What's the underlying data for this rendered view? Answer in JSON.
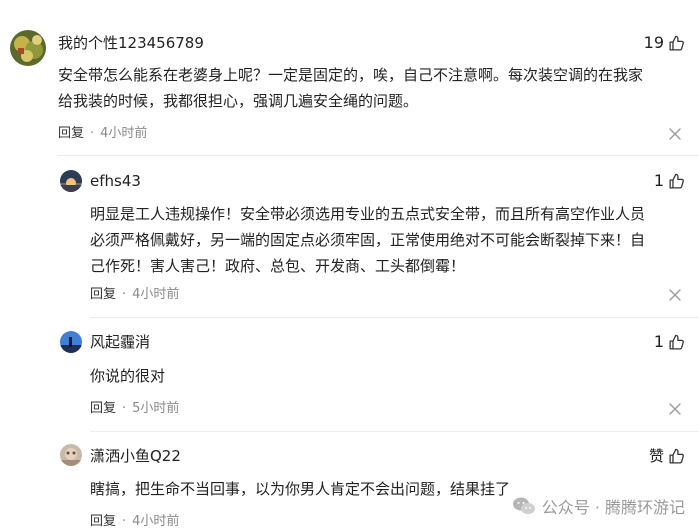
{
  "comments": [
    {
      "username": "我的个性123456789",
      "likes": "19",
      "lines": [
        "安全带怎么能系在老婆身上呢？一定是固定的，唉，自己不注意啊。每次装空调的在我家",
        "给我装的时候，我都很担心，强调几遍安全绳的问题。"
      ],
      "reply_label": "回复",
      "dot": "·",
      "time": "4小时前"
    },
    {
      "username": "efhs43",
      "likes": "1",
      "lines": [
        "明显是工人违规操作！安全带必须选用专业的五点式安全带，而且所有高空作业人员",
        "必须严格佩戴好，另一端的固定点必须牢固，正常使用绝对不可能会断裂掉下来！自",
        "己作死！害人害己！政府、总包、开发商、工头都倒霉！"
      ],
      "reply_label": "回复",
      "dot": "·",
      "time": "4小时前"
    },
    {
      "username": "风起霾消",
      "likes": "1",
      "lines": [
        "你说的很对"
      ],
      "reply_label": "回复",
      "dot": "·",
      "time": "5小时前"
    },
    {
      "username": "潇洒小鱼Q22",
      "likes": "赞",
      "lines": [
        "瞎搞，把生命不当回事，以为你男人肯定不会出问题，结果挂了"
      ],
      "reply_label": "回复",
      "dot": "·",
      "time": "4小时前"
    }
  ],
  "watermark": {
    "text": "公众号 · 腾腾环游记",
    "icon": "wechat-icon"
  },
  "icons": {
    "like": "thumbs-up-icon",
    "close": "close-icon"
  },
  "colors": {
    "text": "#222222",
    "meta": "#8a8a8a",
    "watermark": "#9a9a9a"
  }
}
